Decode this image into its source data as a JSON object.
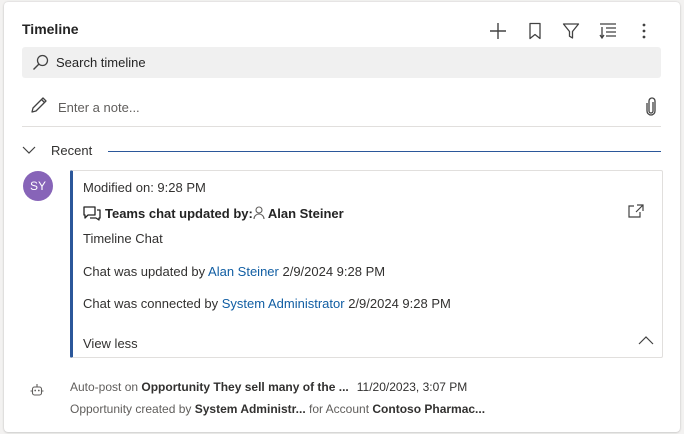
{
  "timeline": {
    "title": "Timeline",
    "toolbar_icons": [
      "add-icon",
      "bookmark-icon",
      "filter-icon",
      "sort-list-icon",
      "more-icon"
    ]
  },
  "search": {
    "placeholder": "Search timeline"
  },
  "note": {
    "placeholder": "Enter a note..."
  },
  "recent": {
    "label": "Recent"
  },
  "card": {
    "avatar_initials": "SY",
    "modified": "Modified on: 9:28 PM",
    "heading_prefix": "Teams chat updated by:",
    "heading_name": "Alan Steiner",
    "subtitle": "Timeline Chat",
    "line1": {
      "prefix": "Chat was updated by ",
      "link": "Alan Steiner",
      "suffix": " 2/9/2024 9:28 PM"
    },
    "line2": {
      "prefix": "Chat was connected by ",
      "link": "System Administrator",
      "suffix": " 2/9/2024 9:28 PM"
    },
    "view_less": "View less"
  },
  "autopost": {
    "prefix": "Auto-post on ",
    "entity": "Opportunity They sell many of the ...",
    "date": "11/20/2023, 3:07 PM",
    "line2_prefix": "Opportunity created by ",
    "creator": "System Administr...",
    "line2_mid": " for Account ",
    "account": "Contoso Pharmac..."
  },
  "colors": {
    "accent": "#2b579a",
    "link": "#115ea3",
    "avatar": "#8764b8"
  }
}
